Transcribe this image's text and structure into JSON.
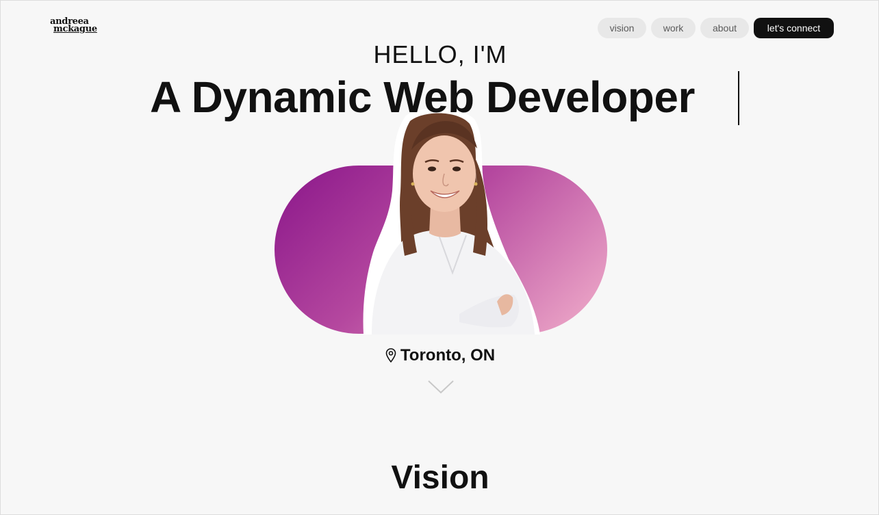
{
  "logo": {
    "line1": "andreea",
    "line2": "mckague"
  },
  "nav": {
    "items": [
      {
        "label": "vision"
      },
      {
        "label": "work"
      },
      {
        "label": "about"
      },
      {
        "label": "let's connect"
      }
    ]
  },
  "hero": {
    "greeting": "HELLO, I'M",
    "headline": "A Dynamic Web Developer",
    "location": "Toronto, ON"
  },
  "sections": {
    "vision_title": "Vision"
  },
  "colors": {
    "gradient_start": "#8a168a",
    "gradient_end": "#f2b0cb",
    "primary_dark": "#111111",
    "nav_pill": "#e8e8e8",
    "background": "#f7f7f7"
  },
  "icons": [
    "location-pin-icon",
    "chevron-down-icon"
  ]
}
